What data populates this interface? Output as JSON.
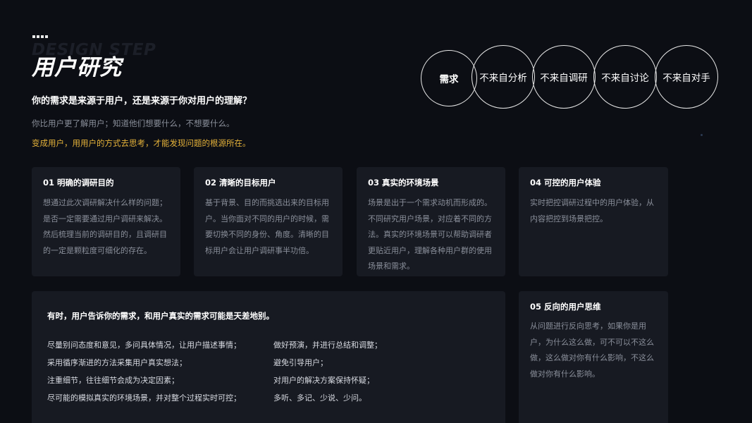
{
  "header": {
    "bg_word": "DESIGN STEP",
    "title": "用户研究",
    "question": "你的需求是来源于用户，还是来源于你对用户的理解？",
    "subtext": "你比用户更了解用户；知道他们想要什么，不想要什么。",
    "highlight": "变成用户，用用户的方式去思考，才能发现问题的根源所在。",
    "highlight_color": "#e5b23a"
  },
  "circles": [
    "需求",
    "不来自分析",
    "不来自调研",
    "不来自讨论",
    "不来自对手"
  ],
  "cards": [
    {
      "title": "01  明确的调研目的",
      "lines": [
        "想通过此次调研解决什么样的问题；",
        "是否一定需要通过用户调研来解决。",
        "然后梳理当前的调研目的，且调研目",
        "的一定是颗粒度可细化的存在。"
      ]
    },
    {
      "title": "02  清晰的目标用户",
      "lines": [
        "基于背景、目的而挑选出来的目标用",
        "户。当你面对不同的用户的时候，需",
        "要切换不同的身份、角度。清晰的目",
        "标用户会让用户调研事半功倍。"
      ]
    },
    {
      "title": "03   真实的环境场景",
      "lines": [
        "场景是出于一个需求动机而形成的。",
        "不同研究用户场景，对应着不同的方",
        "法。真实的环境场景可以帮助调研者",
        "更贴近用户，理解各种用户群的使用",
        "场景和需求。"
      ]
    },
    {
      "title": "04  可控的用户体验",
      "lines": [
        "实时把控调研过程中的用户体验，从",
        "内容把控到场景把控。"
      ]
    },
    {
      "title": "05  反向的用户思维",
      "lines": [
        "从问题进行反向思考，如果你是用",
        "户，为什么这么做，可不可以不这么",
        "做，这么做对你有什么影响，不这么",
        "做对你有什么影响。"
      ]
    }
  ],
  "bottom": {
    "title": "有时，用户告诉你的需求，和用户真实的需求可能是天差地别。",
    "left": [
      "尽量别问态度和意见，多问具体情况，让用户描述事情；",
      "采用循序渐进的方法采集用户真实想法；",
      "注重细节，往往细节会成为决定因素；",
      "尽可能的模拟真实的环境场景，并对整个过程实时可控；"
    ],
    "right": [
      "做好预演，并进行总结和调整；",
      "避免引导用户；",
      "对用户的解决方案保持怀疑；",
      "多听、多记、少说、少问。"
    ]
  }
}
